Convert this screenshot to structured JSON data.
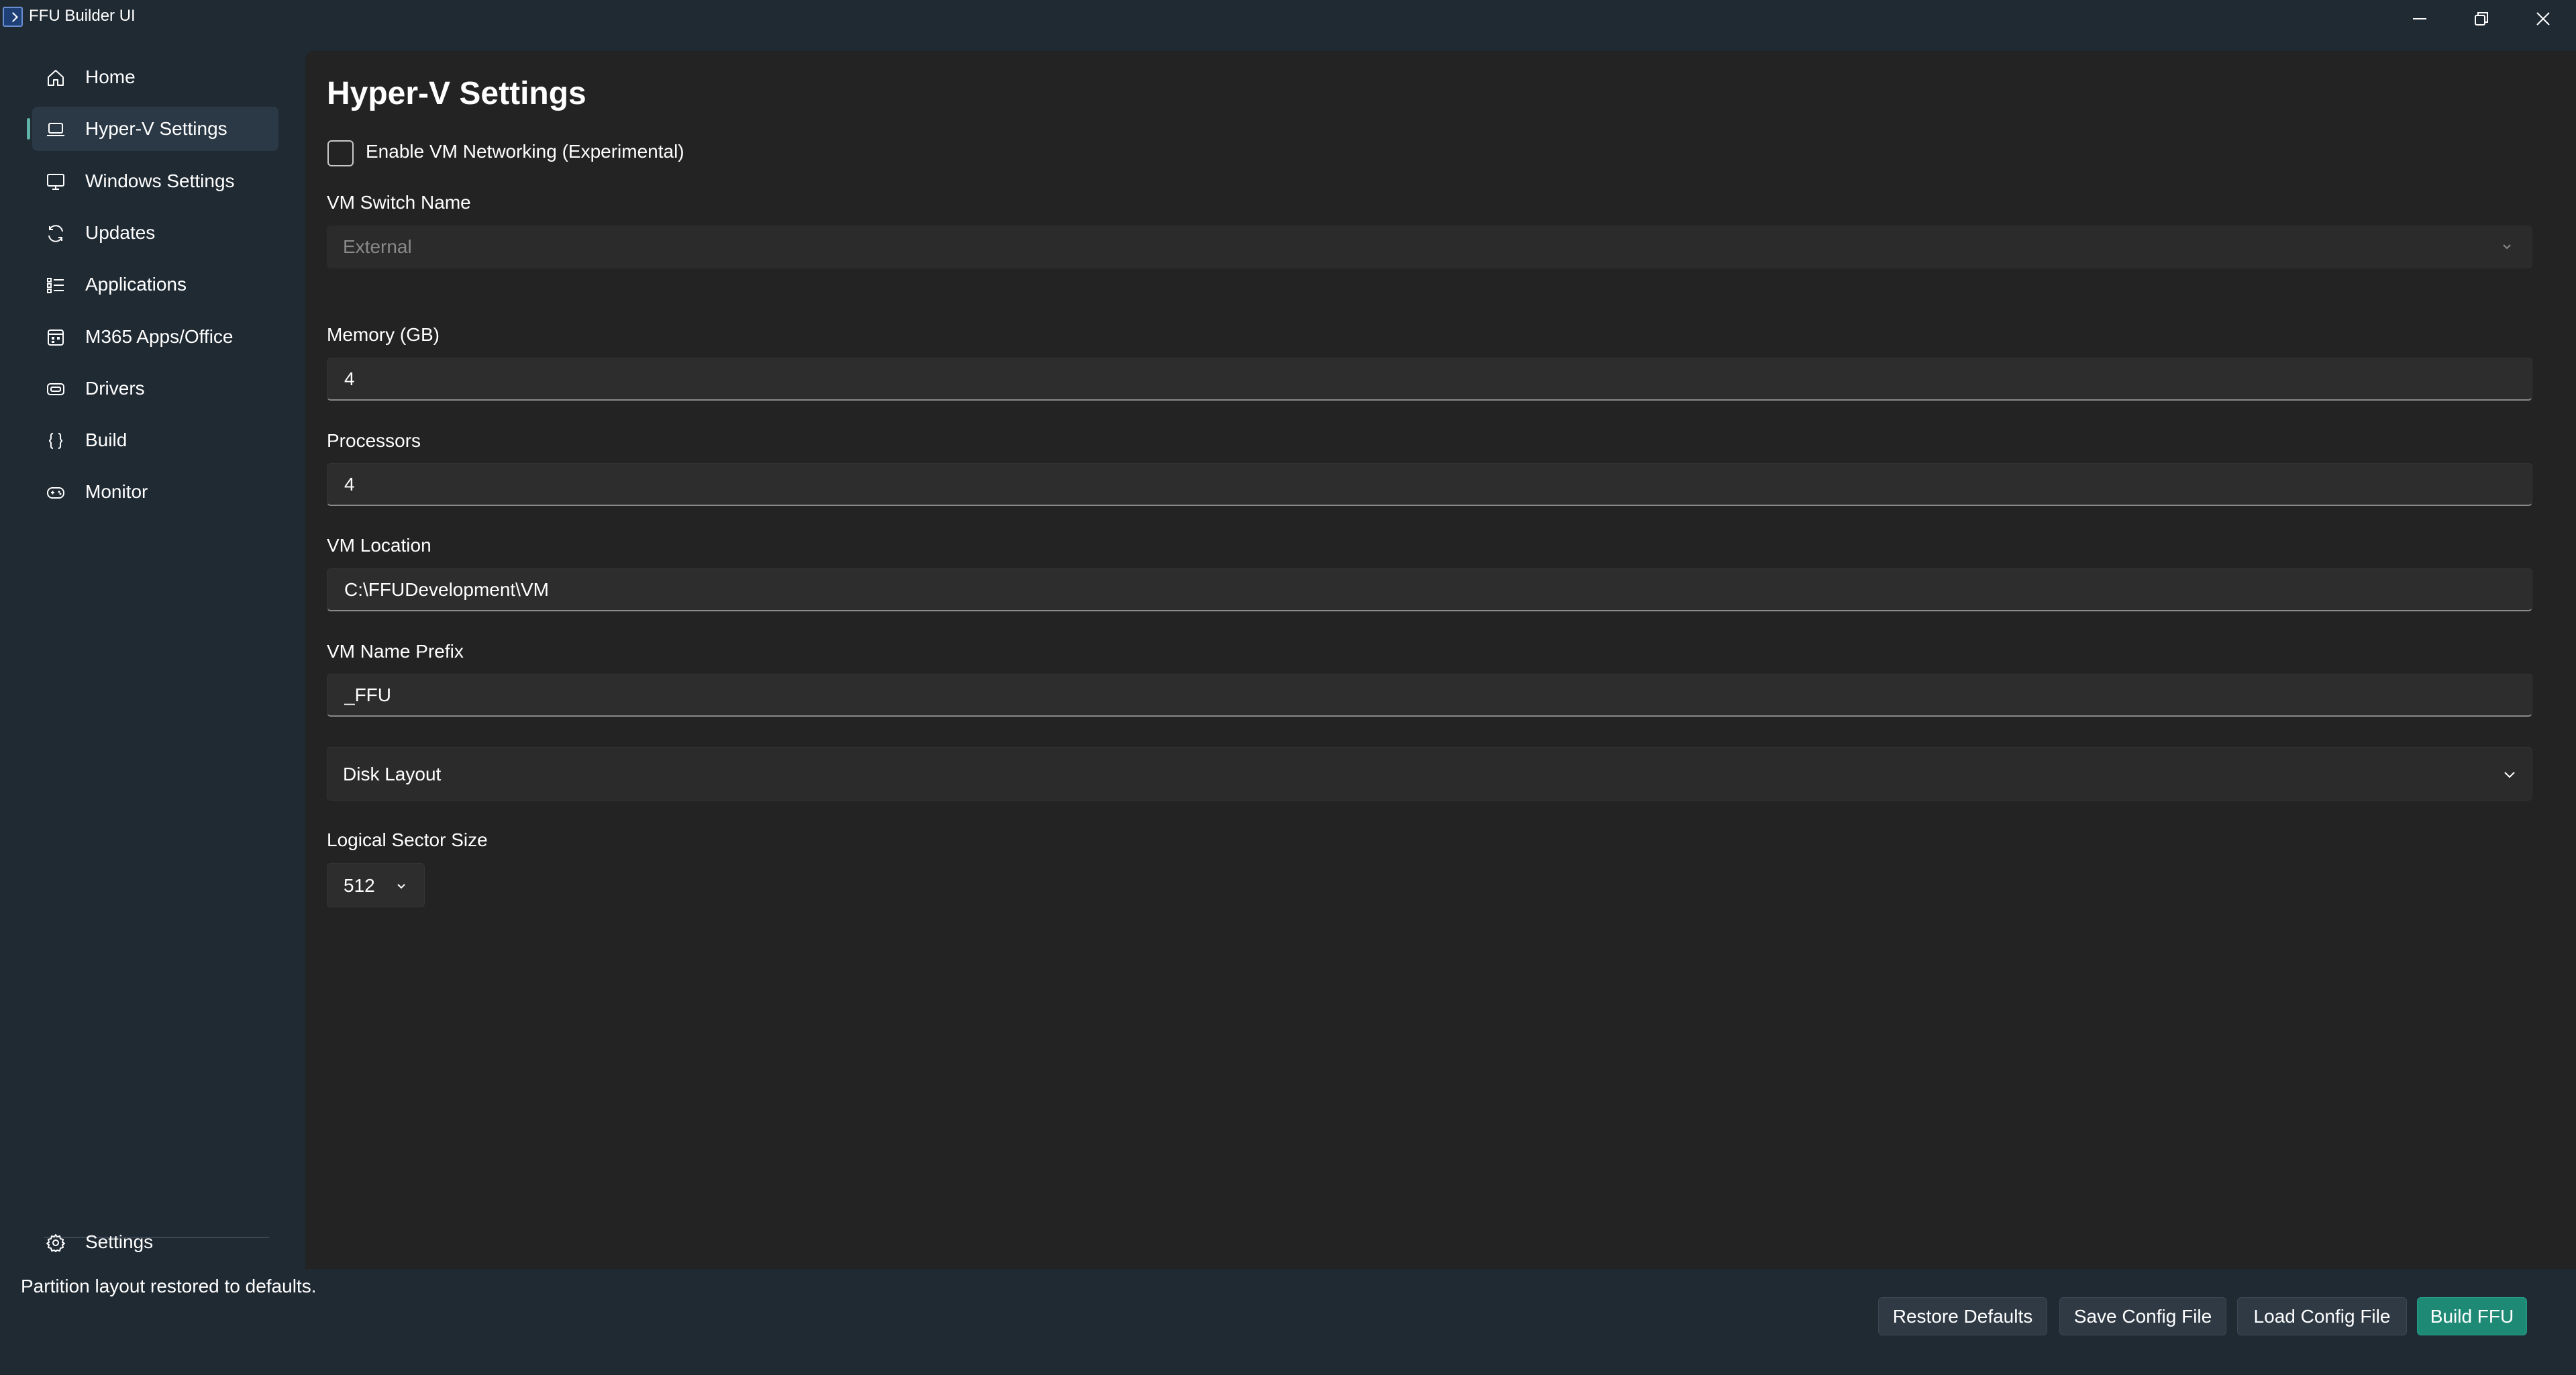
{
  "window": {
    "title": "FFU Builder UI",
    "app_icon": "powershell-icon"
  },
  "sidebar": {
    "items": [
      {
        "label": "Home",
        "icon": "home-icon"
      },
      {
        "label": "Hyper-V Settings",
        "icon": "laptop-icon",
        "active": true
      },
      {
        "label": "Windows Settings",
        "icon": "monitor-icon"
      },
      {
        "label": "Updates",
        "icon": "sync-icon"
      },
      {
        "label": "Applications",
        "icon": "list-icon"
      },
      {
        "label": "M365 Apps/Office",
        "icon": "office-icon"
      },
      {
        "label": "Drivers",
        "icon": "drive-icon"
      },
      {
        "label": "Build",
        "icon": "braces-icon"
      },
      {
        "label": "Monitor",
        "icon": "gamepad-icon"
      }
    ],
    "footer": {
      "label": "Settings",
      "icon": "gear-icon"
    }
  },
  "page": {
    "title": "Hyper-V Settings",
    "enable_networking": {
      "label": "Enable VM Networking (Experimental)",
      "checked": false
    },
    "vm_switch": {
      "label": "VM Switch Name",
      "value": "External",
      "disabled": true
    },
    "memory": {
      "label": "Memory (GB)",
      "value": "4"
    },
    "processors": {
      "label": "Processors",
      "value": "4"
    },
    "vm_location": {
      "label": "VM Location",
      "value": "C:\\FFUDevelopment\\VM"
    },
    "vm_name_prefix": {
      "label": "VM Name Prefix",
      "value": "_FFU"
    },
    "disk_layout": {
      "label": "Disk Layout",
      "expanded": false
    },
    "logical_sector_size": {
      "label": "Logical Sector Size",
      "value": "512"
    }
  },
  "status": {
    "message": "Partition layout restored to defaults."
  },
  "actions": {
    "restore_defaults": "Restore Defaults",
    "save_config": "Save Config File",
    "load_config": "Load Config File",
    "build": "Build FFU"
  },
  "colors": {
    "accent": "#1e8a76",
    "indicator": "#5fb3a9",
    "frame_bg": "#202a33",
    "content_bg": "#232323"
  }
}
